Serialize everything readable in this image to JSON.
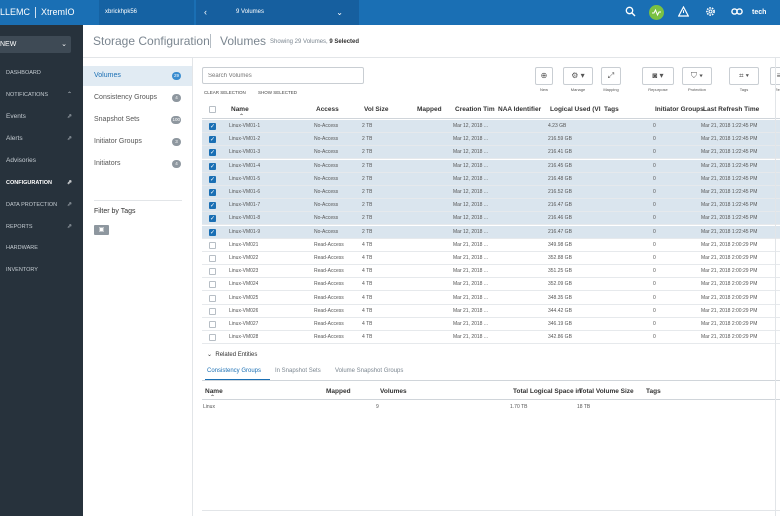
{
  "topbar": {
    "brand_left": "LLEMC",
    "brand_right": "XtremIO",
    "host": "xbrickhpk56",
    "back_chevron": "‹",
    "volumes_label": "9 Volumes",
    "dropdown_chevron": "⌄",
    "user": "tech",
    "icons": [
      "search-icon",
      "health-icon",
      "alert-icon",
      "gear-icon",
      "user-icon"
    ]
  },
  "sidebar": {
    "new_label": "NEW",
    "items": [
      {
        "label": "DASHBOARD",
        "active": false,
        "icon": ""
      },
      {
        "label": "NOTIFICATIONS",
        "active": false,
        "icon": "⌃"
      },
      {
        "label": "Events",
        "active": false,
        "icon": "⇗",
        "sub": true
      },
      {
        "label": "Alerts",
        "active": false,
        "icon": "⇗",
        "sub": true
      },
      {
        "label": "Advisories",
        "active": false,
        "icon": "",
        "sub": true
      },
      {
        "label": "CONFIGURATION",
        "active": true,
        "icon": "⇗"
      },
      {
        "label": "DATA PROTECTION",
        "active": false,
        "icon": "⇗"
      },
      {
        "label": "REPORTS",
        "active": false,
        "icon": "⇗"
      },
      {
        "label": "HARDWARE",
        "active": false,
        "icon": ""
      },
      {
        "label": "INVENTORY",
        "active": false,
        "icon": ""
      }
    ]
  },
  "header": {
    "title": "Storage Configuration",
    "section": "Volumes",
    "count_prefix": "Showing 29 Volumes,",
    "count_selected": "9 Selected"
  },
  "subnav": {
    "items": [
      {
        "label": "Volumes",
        "count": "29",
        "active": true
      },
      {
        "label": "Consistency Groups",
        "count": "4",
        "active": false
      },
      {
        "label": "Snapshot Sets",
        "count": "100",
        "active": false
      },
      {
        "label": "Initiator Groups",
        "count": "3",
        "active": false
      },
      {
        "label": "Initiators",
        "count": "4",
        "active": false
      }
    ],
    "filter_label": "Filter by Tags",
    "filter_icon": "▣"
  },
  "toolbar": {
    "search_placeholder": "Search Volumes",
    "clear_selection": "CLEAR SELECTION",
    "show_selected": "SHOW SELECTED",
    "buttons": [
      {
        "label": "New",
        "glyph": "⊕"
      },
      {
        "label": "Manage",
        "glyph": "⚙ ▾"
      },
      {
        "label": "Mapping",
        "glyph": "⤢"
      },
      {
        "label": "Repurpose",
        "glyph": "◙ ▾"
      },
      {
        "label": "Protection",
        "glyph": "⛉ ▾"
      },
      {
        "label": "Tags",
        "glyph": "⌗ ▾"
      },
      {
        "label": "Rem",
        "glyph": "≡"
      }
    ]
  },
  "table": {
    "columns": [
      "Name",
      "Access",
      "Vol Size",
      "Mapped",
      "Creation Tim",
      "NAA Identifier",
      "Logical Used (VI",
      "Tags",
      "Initiator Groups",
      "Last Refresh Time"
    ],
    "rows": [
      {
        "checked": true,
        "name": "Linux-VM01-1",
        "access": "No-Access",
        "size": "2 TB",
        "mapped": "",
        "created": "Mar 12, 2018 ...",
        "naa": "",
        "used": "4.23 GB",
        "tags": "",
        "ig": "0",
        "refresh": "Mar 21, 2018 1:22:45 PM"
      },
      {
        "checked": true,
        "name": "Linux-VM01-2",
        "access": "No-Access",
        "size": "2 TB",
        "mapped": "",
        "created": "Mar 12, 2018 ...",
        "naa": "",
        "used": "216.59 GB",
        "tags": "",
        "ig": "0",
        "refresh": "Mar 21, 2018 1:22:45 PM"
      },
      {
        "checked": true,
        "name": "Linux-VM01-3",
        "access": "No-Access",
        "size": "2 TB",
        "mapped": "",
        "created": "Mar 12, 2018 ...",
        "naa": "",
        "used": "216.41 GB",
        "tags": "",
        "ig": "0",
        "refresh": "Mar 21, 2018 1:22:45 PM"
      },
      {
        "checked": true,
        "name": "Linux-VM01-4",
        "access": "No-Access",
        "size": "2 TB",
        "mapped": "",
        "created": "Mar 12, 2018 ...",
        "naa": "",
        "used": "216.45 GB",
        "tags": "",
        "ig": "0",
        "refresh": "Mar 21, 2018 1:22:45 PM"
      },
      {
        "checked": true,
        "name": "Linux-VM01-5",
        "access": "No-Access",
        "size": "2 TB",
        "mapped": "",
        "created": "Mar 12, 2018 ...",
        "naa": "",
        "used": "216.48 GB",
        "tags": "",
        "ig": "0",
        "refresh": "Mar 21, 2018 1:22:45 PM"
      },
      {
        "checked": true,
        "name": "Linux-VM01-6",
        "access": "No-Access",
        "size": "2 TB",
        "mapped": "",
        "created": "Mar 12, 2018 ...",
        "naa": "",
        "used": "216.52 GB",
        "tags": "",
        "ig": "0",
        "refresh": "Mar 21, 2018 1:22:45 PM"
      },
      {
        "checked": true,
        "name": "Linux-VM01-7",
        "access": "No-Access",
        "size": "2 TB",
        "mapped": "",
        "created": "Mar 12, 2018 ...",
        "naa": "",
        "used": "216.47 GB",
        "tags": "",
        "ig": "0",
        "refresh": "Mar 21, 2018 1:22:45 PM"
      },
      {
        "checked": true,
        "name": "Linux-VM01-8",
        "access": "No-Access",
        "size": "2 TB",
        "mapped": "",
        "created": "Mar 12, 2018 ...",
        "naa": "",
        "used": "216.46 GB",
        "tags": "",
        "ig": "0",
        "refresh": "Mar 21, 2018 1:22:45 PM"
      },
      {
        "checked": true,
        "name": "Linux-VM01-9",
        "access": "No-Access",
        "size": "2 TB",
        "mapped": "",
        "created": "Mar 12, 2018 ...",
        "naa": "",
        "used": "216.47 GB",
        "tags": "",
        "ig": "0",
        "refresh": "Mar 21, 2018 1:22:45 PM"
      },
      {
        "checked": false,
        "name": "Linux-VM021",
        "access": "Read-Access",
        "size": "4 TB",
        "mapped": "",
        "created": "Mar 21, 2018 ...",
        "naa": "",
        "used": "349.98 GB",
        "tags": "",
        "ig": "0",
        "refresh": "Mar 21, 2018 2:00:29 PM"
      },
      {
        "checked": false,
        "name": "Linux-VM022",
        "access": "Read-Access",
        "size": "4 TB",
        "mapped": "",
        "created": "Mar 21, 2018 ...",
        "naa": "",
        "used": "352.88 GB",
        "tags": "",
        "ig": "0",
        "refresh": "Mar 21, 2018 2:00:29 PM"
      },
      {
        "checked": false,
        "name": "Linux-VM023",
        "access": "Read-Access",
        "size": "4 TB",
        "mapped": "",
        "created": "Mar 21, 2018 ...",
        "naa": "",
        "used": "351.25 GB",
        "tags": "",
        "ig": "0",
        "refresh": "Mar 21, 2018 2:00:29 PM"
      },
      {
        "checked": false,
        "name": "Linux-VM024",
        "access": "Read-Access",
        "size": "4 TB",
        "mapped": "",
        "created": "Mar 21, 2018 ...",
        "naa": "",
        "used": "352.09 GB",
        "tags": "",
        "ig": "0",
        "refresh": "Mar 21, 2018 2:00:29 PM"
      },
      {
        "checked": false,
        "name": "Linux-VM025",
        "access": "Read-Access",
        "size": "4 TB",
        "mapped": "",
        "created": "Mar 21, 2018 ...",
        "naa": "",
        "used": "348.35 GB",
        "tags": "",
        "ig": "0",
        "refresh": "Mar 21, 2018 2:00:29 PM"
      },
      {
        "checked": false,
        "name": "Linux-VM026",
        "access": "Read-Access",
        "size": "4 TB",
        "mapped": "",
        "created": "Mar 21, 2018 ...",
        "naa": "",
        "used": "344.42 GB",
        "tags": "",
        "ig": "0",
        "refresh": "Mar 21, 2018 2:00:29 PM"
      },
      {
        "checked": false,
        "name": "Linux-VM027",
        "access": "Read-Access",
        "size": "4 TB",
        "mapped": "",
        "created": "Mar 21, 2018 ...",
        "naa": "",
        "used": "346.19 GB",
        "tags": "",
        "ig": "0",
        "refresh": "Mar 21, 2018 2:00:29 PM"
      },
      {
        "checked": false,
        "name": "Linux-VM028",
        "access": "Read-Access",
        "size": "4 TB",
        "mapped": "",
        "created": "Mar 21, 2018 ...",
        "naa": "",
        "used": "342.86 GB",
        "tags": "",
        "ig": "0",
        "refresh": "Mar 21, 2018 2:00:29 PM"
      }
    ]
  },
  "related": {
    "title": "Related Entities",
    "tabs": [
      {
        "label": "Consistency Groups",
        "active": true
      },
      {
        "label": "In Snapshot Sets",
        "active": false
      },
      {
        "label": "Volume Snapshot Groups",
        "active": false
      }
    ],
    "columns": [
      "Name",
      "Mapped",
      "Volumes",
      "Total Logical Space in",
      "Total Volume Size",
      "Tags"
    ],
    "rows": [
      {
        "name": "Linux",
        "mapped": "",
        "volumes": "9",
        "logical": "1.70 TB",
        "size": "18 TB",
        "tags": ""
      }
    ]
  }
}
